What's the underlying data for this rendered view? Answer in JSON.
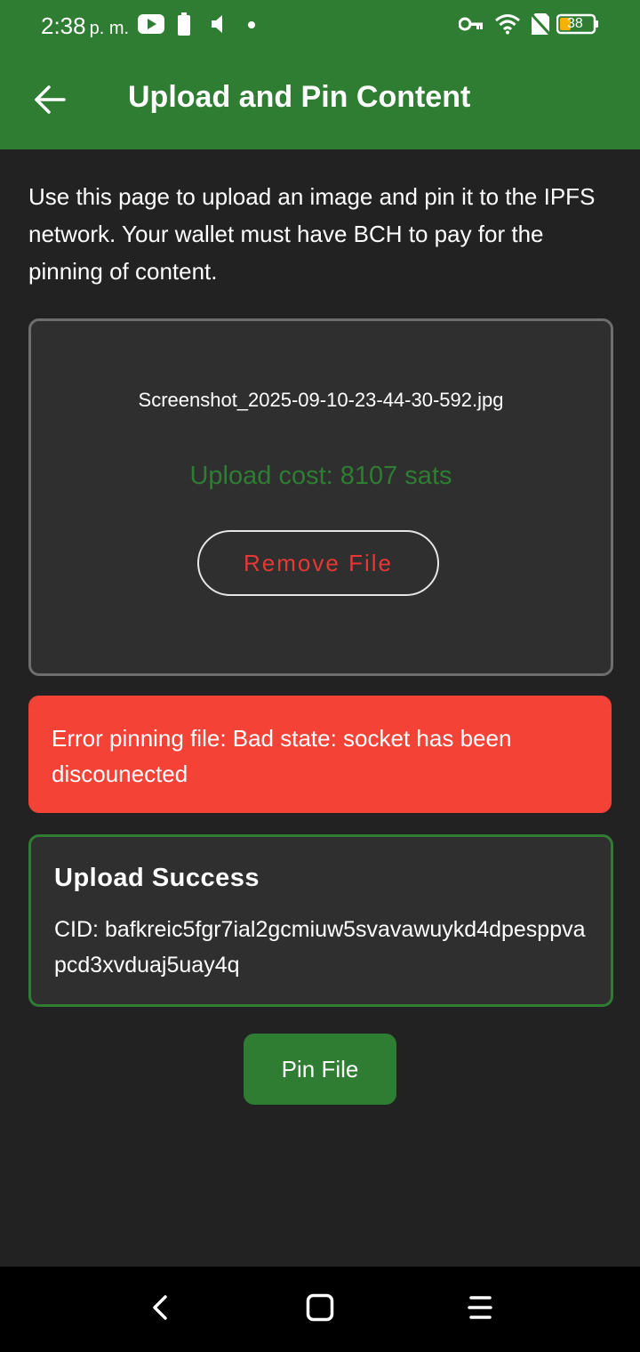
{
  "status_bar": {
    "time": "2:38",
    "ampm": "p. m.",
    "battery_level": "38",
    "left_icons": [
      "youtube-icon",
      "battery-saver-icon",
      "volume-mute-icon",
      "dot-icon"
    ],
    "right_icons": [
      "vpn-key-icon",
      "wifi-icon",
      "no-sim-icon",
      "battery-icon"
    ]
  },
  "app_bar": {
    "title": "Upload and Pin Content",
    "back_icon": "arrow-back-icon"
  },
  "intro": {
    "text": "Use this page to upload an image and pin it to the IPFS network. Your wallet must have BCH to pay for the pinning of content."
  },
  "file_card": {
    "file_name": "Screenshot_2025-09-10-23-44-30-592.jpg",
    "upload_cost": "Upload cost: 8107 sats",
    "remove_label": "Remove File"
  },
  "error": {
    "message": "Error pinning file: Bad state: socket has been discounected"
  },
  "success": {
    "title": "Upload Success",
    "cid": "CID: bafkreic5fgr7ial2gcmiuw5svavawuykd4dpesppvapcd3xvduaj5uay4q"
  },
  "actions": {
    "pin_label": "Pin File"
  },
  "nav_bar": {
    "items": [
      "back-nav-icon",
      "home-nav-icon",
      "menu-nav-icon"
    ]
  },
  "colors": {
    "primary_green": "#2e7d32",
    "background": "#222222",
    "card": "#2f2f2f",
    "error_red": "#f44336",
    "remove_text_red": "#e53935"
  }
}
